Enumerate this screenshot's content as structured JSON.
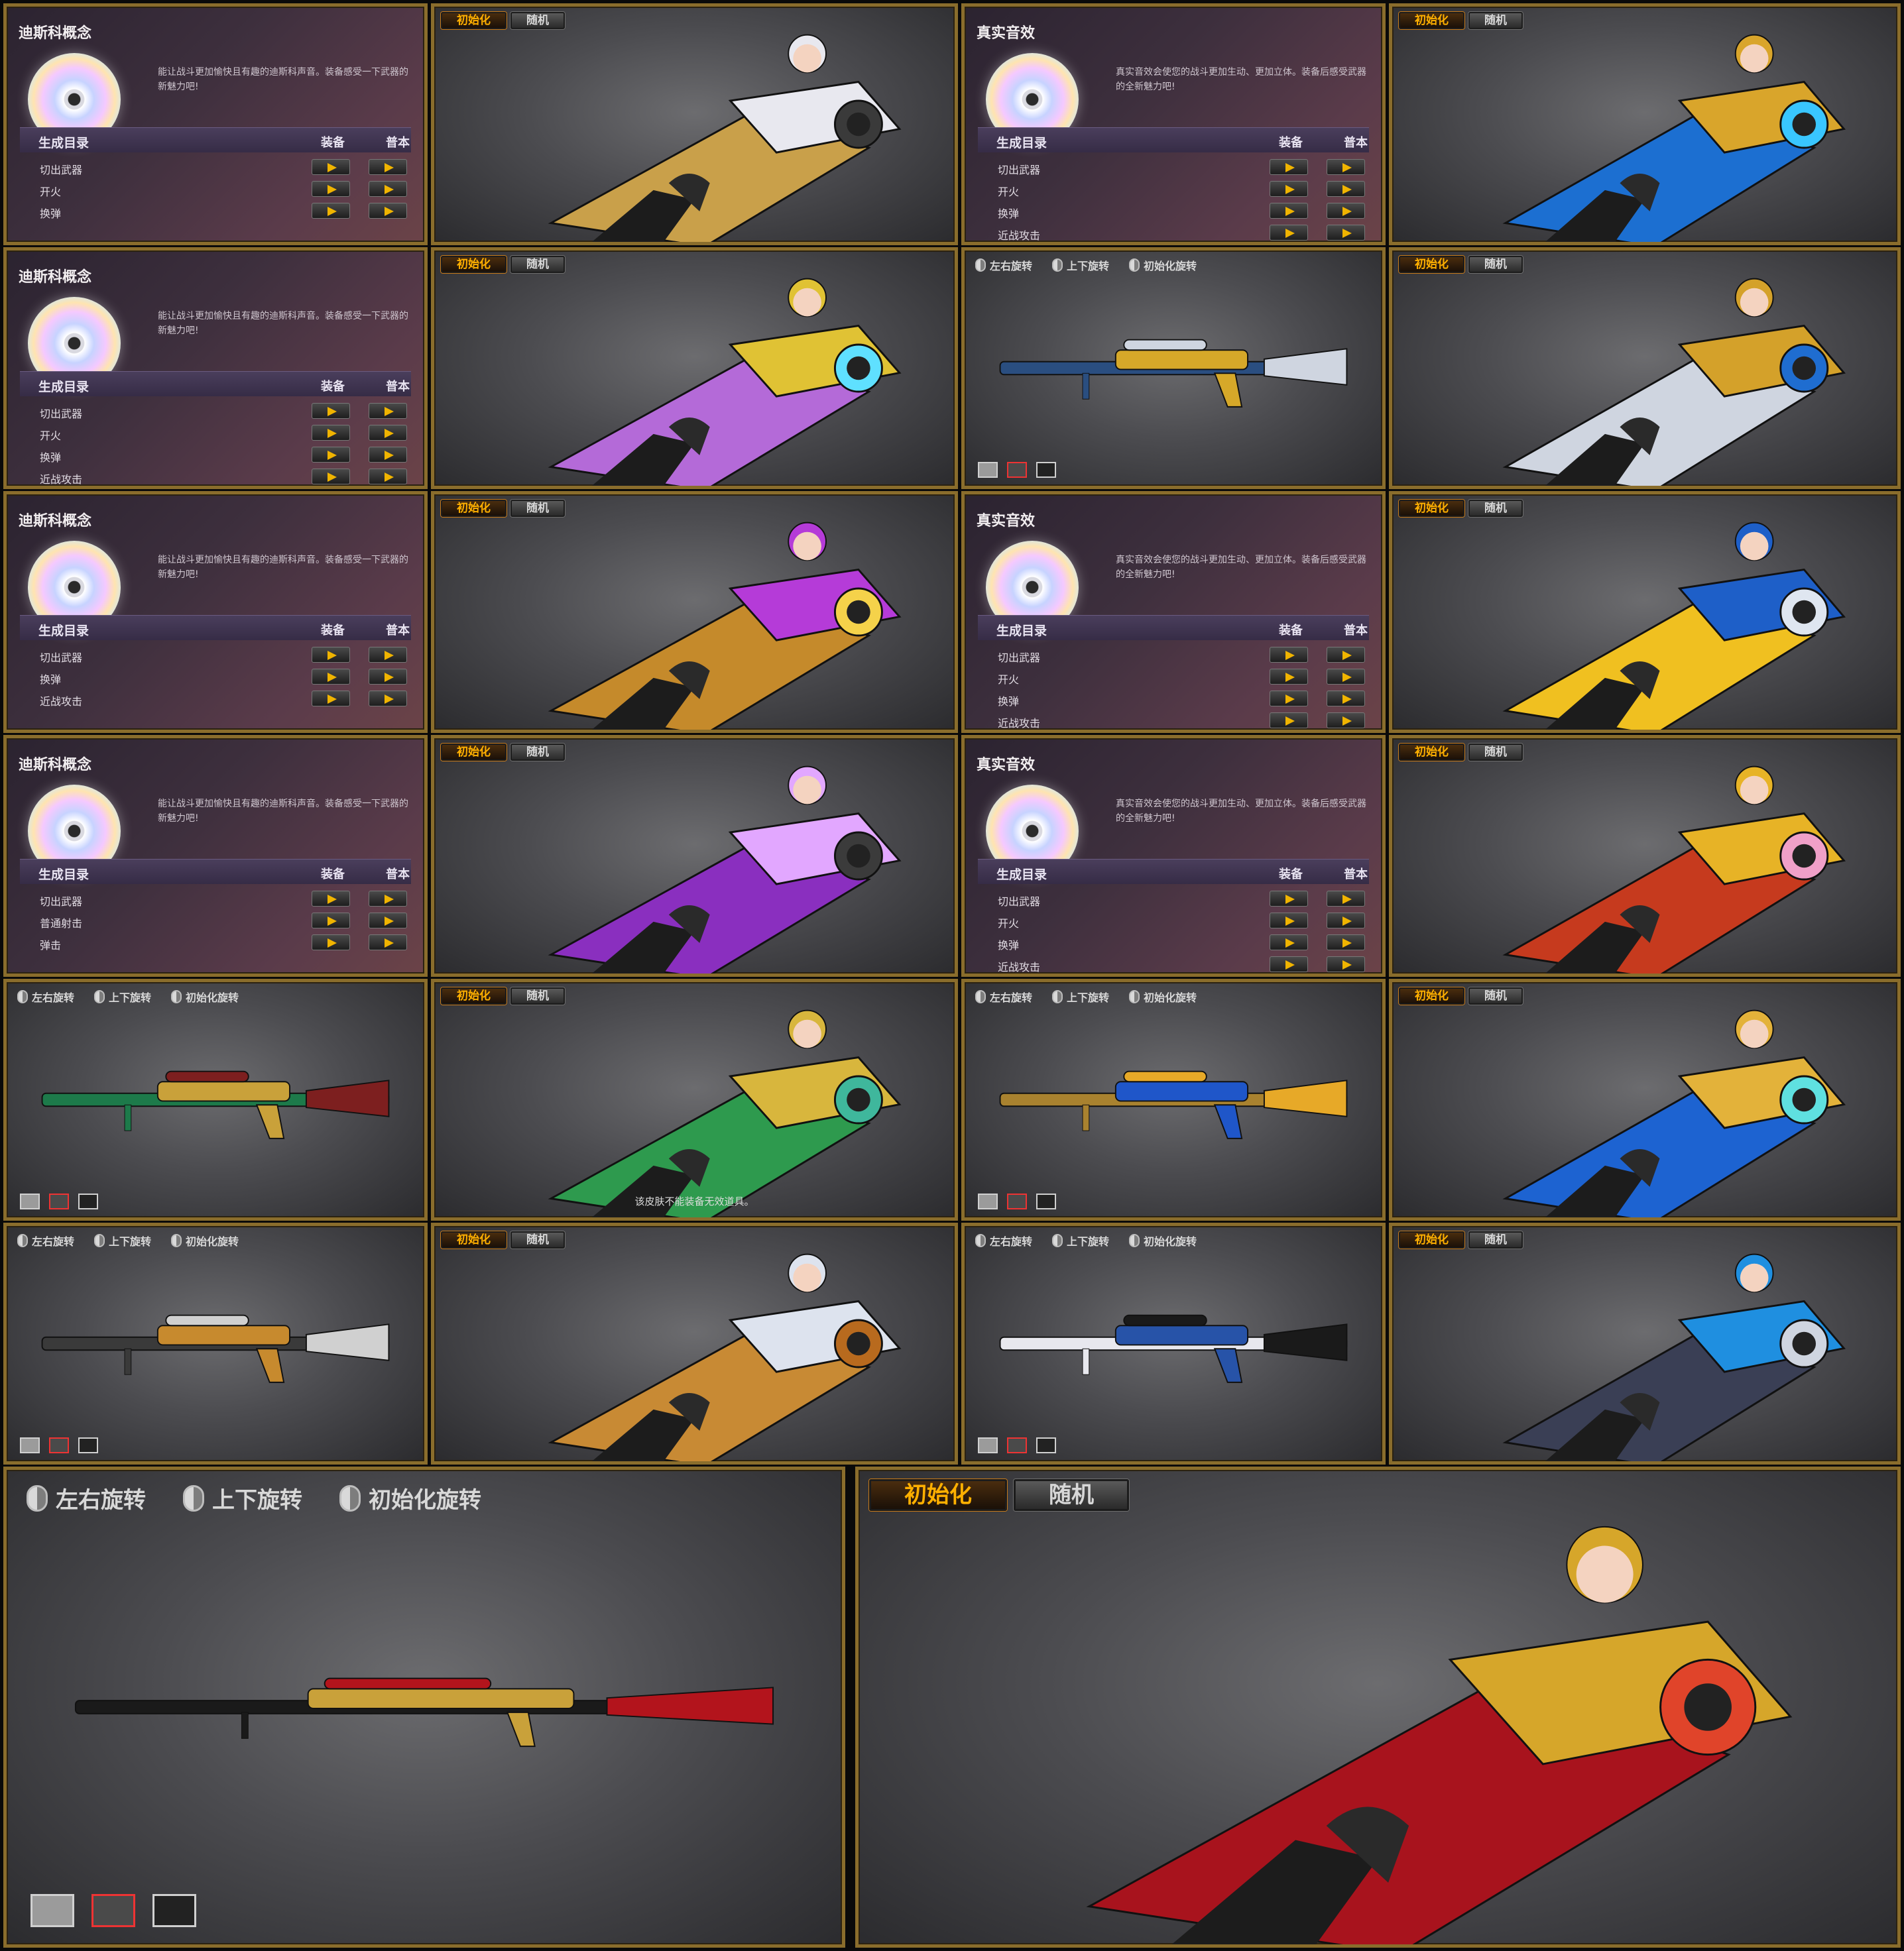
{
  "sound_panels": {
    "disco": {
      "title": "迪斯科概念",
      "description": "能让战斗更加愉快且有趣的迪斯科声音。装备感受一下武器的新魅力吧!",
      "table_title": "生成目录",
      "col_equip": "装备",
      "col_original": "普本"
    },
    "real": {
      "title": "真实音效",
      "description": "真实音效会使您的战斗更加生动、更加立体。装备后感受武器的全新魅力吧!",
      "table_title": "生成目录",
      "col_equip": "装备",
      "col_original": "普本"
    },
    "rows": {
      "r1": [
        "切出武器",
        "开火",
        "换弹"
      ],
      "r2": [
        "切出武器",
        "开火",
        "换弹",
        "近战攻击"
      ],
      "r3": [
        "切出武器",
        "换弹",
        "近战攻击"
      ],
      "r4": [
        "切出武器",
        "普通射击",
        "弹击"
      ]
    }
  },
  "preview_buttons": {
    "reset": "初始化",
    "random": "随机"
  },
  "rotation_controls": {
    "left_right": "左右旋转",
    "up_down": "上下旋转",
    "reset_rotation": "初始化旋转"
  },
  "notice": "该皮肤不能装备无效道具。",
  "colors": {
    "frame_gold": "#8a6d2c",
    "accent_orange": "#ffb000",
    "play_yellow": "#f0b400",
    "sound_purple": "#4a3e5c"
  },
  "icons": [
    "disc-icon",
    "play-icon",
    "mouse-icon"
  ]
}
